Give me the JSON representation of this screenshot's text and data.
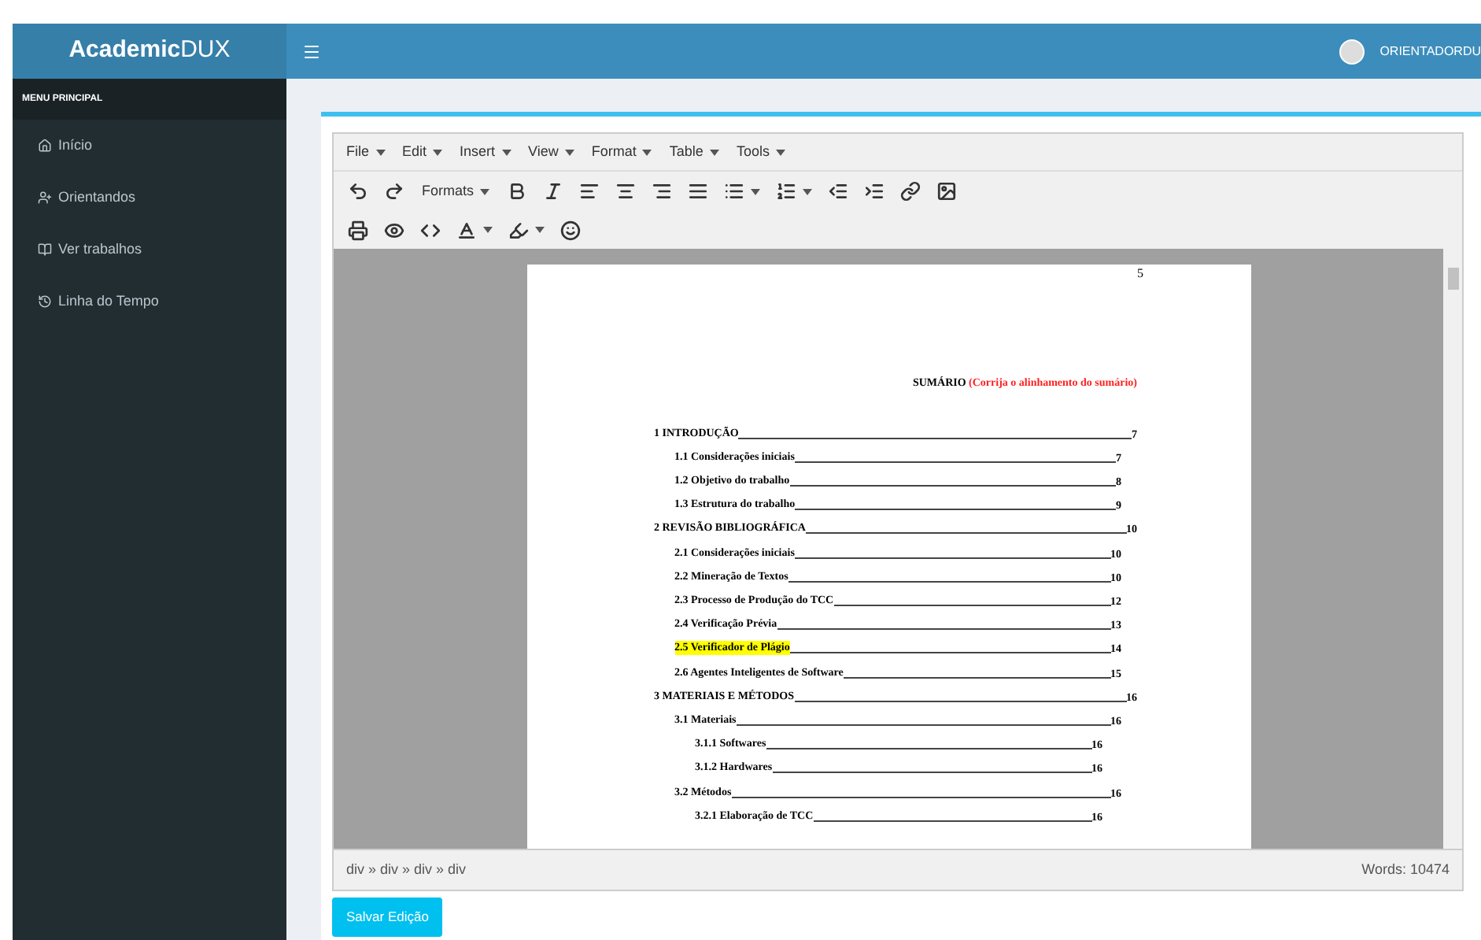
{
  "header": {
    "logo_bold": "Academic",
    "logo_light": "DUX",
    "user_name": "ORIENTADORDU"
  },
  "sidebar": {
    "heading": "MENU PRINCIPAL",
    "items": [
      {
        "label": "Início",
        "kind": "home"
      },
      {
        "label": "Orientandos",
        "kind": "users"
      },
      {
        "label": "Ver trabalhos",
        "kind": "book"
      },
      {
        "label": "Linha do Tempo",
        "kind": "history"
      }
    ]
  },
  "editor": {
    "menubar": [
      "File",
      "Edit",
      "Insert",
      "View",
      "Format",
      "Table",
      "Tools"
    ],
    "formats_label": "Formats",
    "document": {
      "page_number": "5",
      "title": "SUMÁRIO",
      "title_note": "(Corrija o alinhamento do sumário)",
      "toc": [
        {
          "text": "1 INTRODUÇÃO",
          "page": "7",
          "highlighted": false,
          "children": [
            {
              "text": "1.1 Considerações iniciais",
              "page": "7",
              "highlighted": false
            },
            {
              "text": "1.2 Objetivo do trabalho",
              "page": "8",
              "highlighted": false
            },
            {
              "text": "1.3 Estrutura do trabalho",
              "page": "9",
              "highlighted": false
            }
          ]
        },
        {
          "text": "2 REVISÃO BIBLIOGRÁFICA",
          "page": "10",
          "highlighted": false,
          "children": [
            {
              "text": "2.1 Considerações iniciais",
              "page": "10",
              "highlighted": false
            },
            {
              "text": "2.2 Mineração de Textos",
              "page": "10",
              "highlighted": false
            },
            {
              "text": "2.3 Processo de Produção do TCC",
              "page": "12",
              "highlighted": false
            },
            {
              "text": "2.4 Verificação Prévia",
              "page": "13",
              "highlighted": false
            },
            {
              "text": "2.5 Verificador de Plágio",
              "page": "14",
              "highlighted": true
            },
            {
              "text": "2.6 Agentes Inteligentes de Software",
              "page": "15",
              "highlighted": false
            }
          ]
        },
        {
          "text": "3 MATERIAIS E MÉTODOS",
          "page": "16",
          "highlighted": false,
          "children": [
            {
              "text": "3.1 Materiais",
              "page": "16",
              "highlighted": false,
              "children": [
                {
                  "text": "3.1.1 Softwares",
                  "page": "16",
                  "highlighted": false
                },
                {
                  "text": "3.1.2 Hardwares",
                  "page": "16",
                  "highlighted": false
                }
              ]
            },
            {
              "text": "3.2 Métodos",
              "page": "16",
              "highlighted": false,
              "children": [
                {
                  "text": "3.2.1 Elaboração de TCC",
                  "page": "16",
                  "highlighted": false
                }
              ]
            }
          ]
        }
      ]
    },
    "status_path": "div » div » div » div",
    "word_count": "Words: 10474"
  },
  "save_button": "Salvar Edição"
}
